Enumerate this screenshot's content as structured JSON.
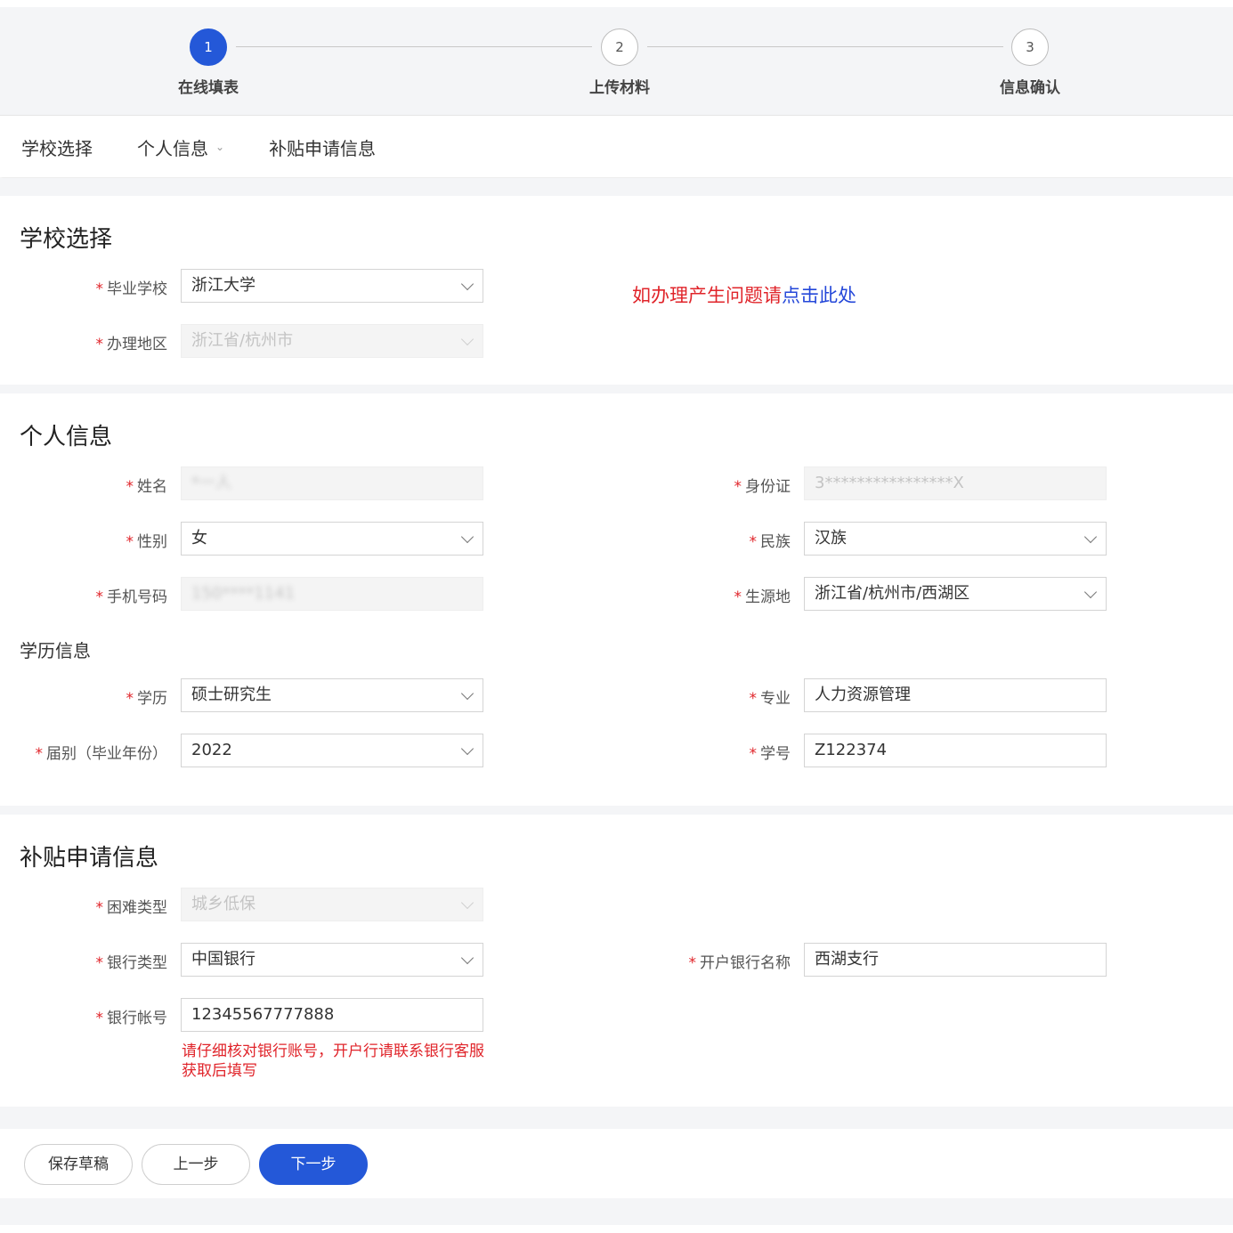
{
  "steps": [
    {
      "number": "1",
      "label": "在线填表"
    },
    {
      "number": "2",
      "label": "上传材料"
    },
    {
      "number": "3",
      "label": "信息确认"
    }
  ],
  "tabs": {
    "school": "学校选择",
    "personal": "个人信息",
    "subsidy": "补贴申请信息"
  },
  "school_section": {
    "title": "学校选择",
    "graduate_school": {
      "label": "毕业学校",
      "value": "浙江大学"
    },
    "region": {
      "label": "办理地区",
      "value": "浙江省/杭州市"
    },
    "help_prefix": "如办理产生问题请",
    "help_link": "点击此处"
  },
  "personal_section": {
    "title": "个人信息",
    "name": {
      "label": "姓名",
      "value": "*一人"
    },
    "id_card": {
      "label": "身份证",
      "value": "3****************X"
    },
    "gender": {
      "label": "性别",
      "value": "女"
    },
    "ethnicity": {
      "label": "民族",
      "value": "汉族"
    },
    "phone": {
      "label": "手机号码",
      "value": "150****1141"
    },
    "origin": {
      "label": "生源地",
      "value": "浙江省/杭州市/西湖区"
    }
  },
  "education": {
    "title": "学历信息",
    "degree": {
      "label": "学历",
      "value": "硕士研究生"
    },
    "major": {
      "label": "专业",
      "value": "人力资源管理"
    },
    "year": {
      "label": "届别（毕业年份）",
      "value": "2022"
    },
    "student_no": {
      "label": "学号",
      "value": "Z122374"
    }
  },
  "subsidy_section": {
    "title": "补贴申请信息",
    "difficulty": {
      "label": "困难类型",
      "value": "城乡低保"
    },
    "bank_type": {
      "label": "银行类型",
      "value": "中国银行"
    },
    "bank_branch": {
      "label": "开户银行名称",
      "value": "西湖支行"
    },
    "account": {
      "label": "银行帐号",
      "value": "12345567777888"
    },
    "hint": "请仔细核对银行账号，开户行请联系银行客服获取后填写"
  },
  "buttons": {
    "save_draft": "保存草稿",
    "prev": "上一步",
    "next": "下一步"
  },
  "colors": {
    "primary": "#2458d8",
    "required": "#e0242a",
    "link": "#2447d9"
  }
}
